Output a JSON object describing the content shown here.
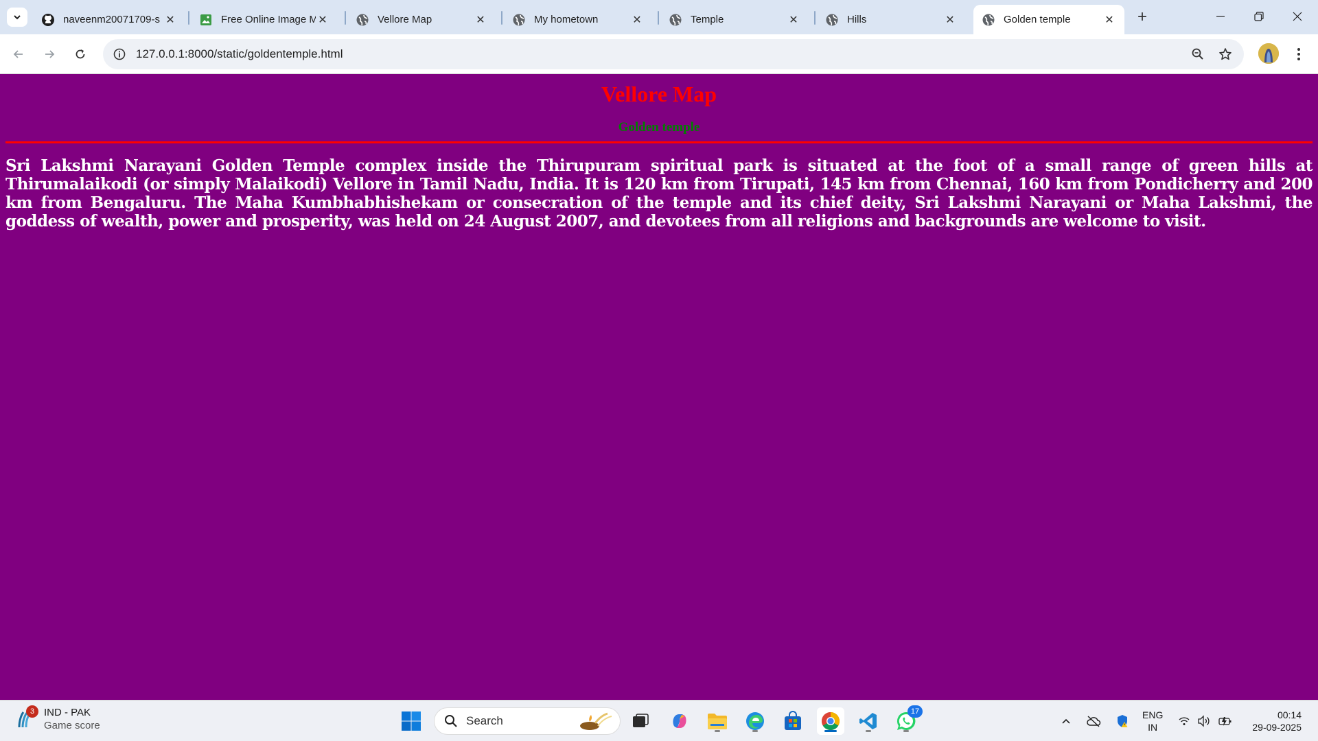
{
  "browser": {
    "tabs": [
      {
        "title": "naveenm20071709-s",
        "icon": "github-icon",
        "active": false
      },
      {
        "title": "Free Online Image M",
        "icon": "image-icon",
        "active": false
      },
      {
        "title": "Vellore Map",
        "icon": "globe-icon",
        "active": false
      },
      {
        "title": "My hometown",
        "icon": "globe-icon",
        "active": false
      },
      {
        "title": "Temple",
        "icon": "globe-icon",
        "active": false
      },
      {
        "title": "Hills",
        "icon": "globe-icon",
        "active": false
      },
      {
        "title": "Golden temple",
        "icon": "globe-icon",
        "active": true
      }
    ],
    "url": "127.0.0.1:8000/static/goldentemple.html"
  },
  "page": {
    "heading": "Vellore Map",
    "subheading": "Golden temple",
    "paragraph": "Sri Lakshmi Narayani Golden Temple complex inside the Thirupuram spiritual park is situated at the foot of a small range of green hills at Thirumalaikodi (or simply Malaikodi) Vellore in Tamil Nadu, India. It is 120 km from Tirupati, 145 km from Chennai, 160 km from Pondicherry and 200 km from Bengaluru. The Maha Kumbhabhishekam or consecration of the temple and its chief deity, Sri Lakshmi Narayani or Maha Lakshmi, the goddess of wealth, power and prosperity, was held on 24 August 2007, and devotees from all religions and backgrounds are welcome to visit.",
    "colors": {
      "background": "#800080",
      "heading": "#ff0000",
      "subheading": "#008000",
      "text": "#ffffff",
      "rule": "#ff0000"
    }
  },
  "taskbar": {
    "widget": {
      "badge": "3",
      "title": "IND - PAK",
      "subtitle": "Game score"
    },
    "search_label": "Search",
    "whatsapp_badge": "17",
    "lang_top": "ENG",
    "lang_bottom": "IN",
    "time": "00:14",
    "date": "29-09-2025"
  }
}
